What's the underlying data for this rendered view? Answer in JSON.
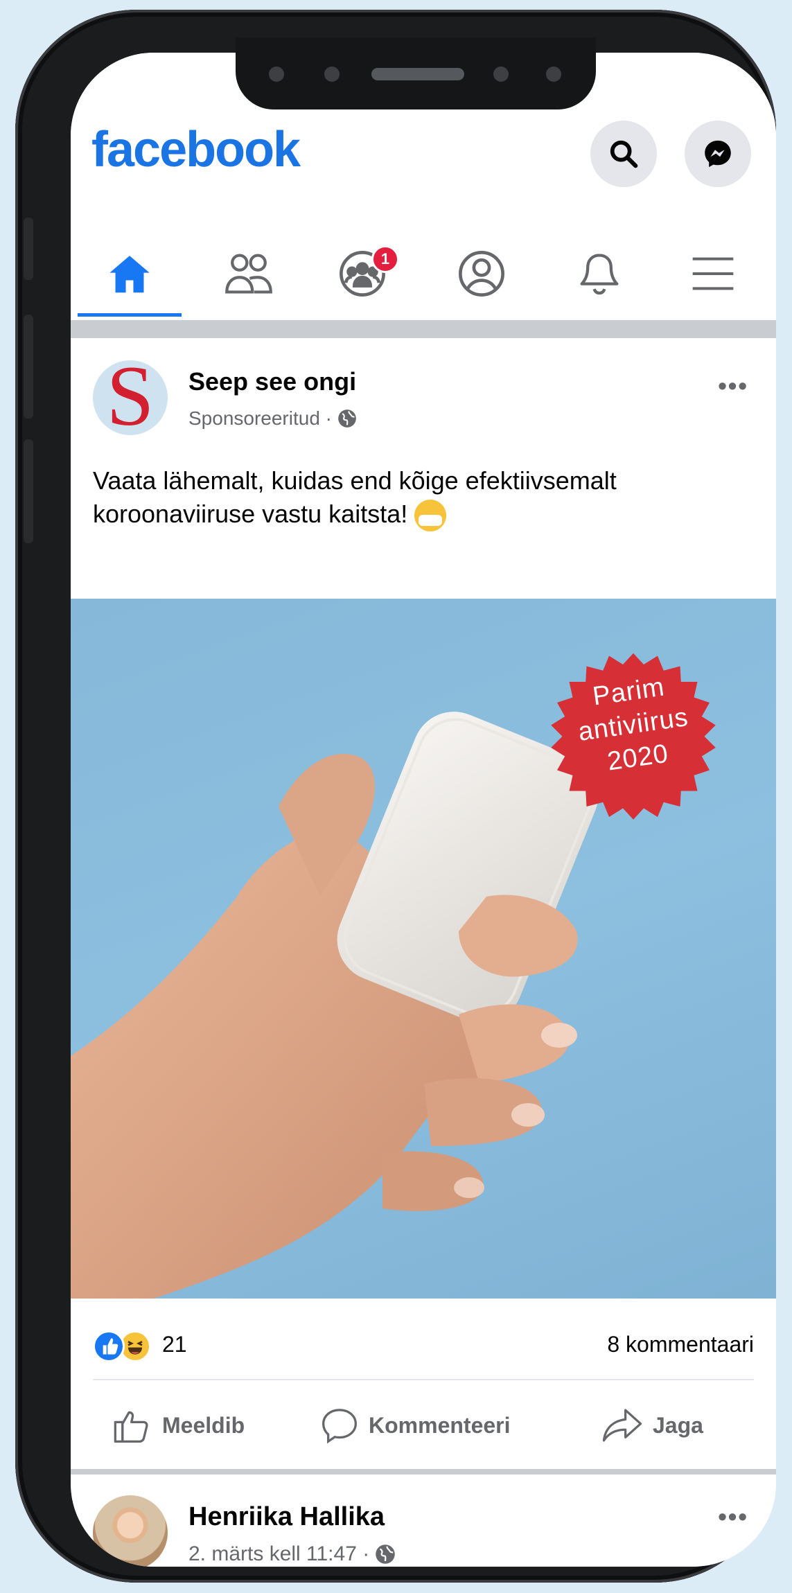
{
  "app": {
    "logo": "facebook",
    "accent_color": "#1877f2"
  },
  "header": {
    "buttons": [
      {
        "name": "search",
        "icon": "search-icon"
      },
      {
        "name": "messenger",
        "icon": "messenger-icon"
      }
    ]
  },
  "tabs": [
    {
      "name": "home",
      "icon": "home-icon",
      "active": true
    },
    {
      "name": "friends",
      "icon": "friends-icon"
    },
    {
      "name": "groups",
      "icon": "groups-icon",
      "badge": "1"
    },
    {
      "name": "profile",
      "icon": "profile-icon"
    },
    {
      "name": "notifications",
      "icon": "bell-icon"
    },
    {
      "name": "menu",
      "icon": "menu-icon"
    }
  ],
  "post": {
    "author": "Seep see ongi",
    "meta": "Sponsoreeritud ·",
    "text": "Vaata lähemalt, kuidas end kõige efektiivsemalt koroonaviiruse vastu kaitsta!",
    "image": {
      "stamp_text": "Parim antiviirus 2020",
      "stamp_color": "#d62f36"
    },
    "reactions_count": "21",
    "comments_label": "8 kommentaari",
    "actions": {
      "like": "Meeldib",
      "comment": "Kommenteeri",
      "share": "Jaga"
    }
  },
  "post2": {
    "author": "Henriika Hallika",
    "meta": "2. märts kell 11:47 ·"
  }
}
